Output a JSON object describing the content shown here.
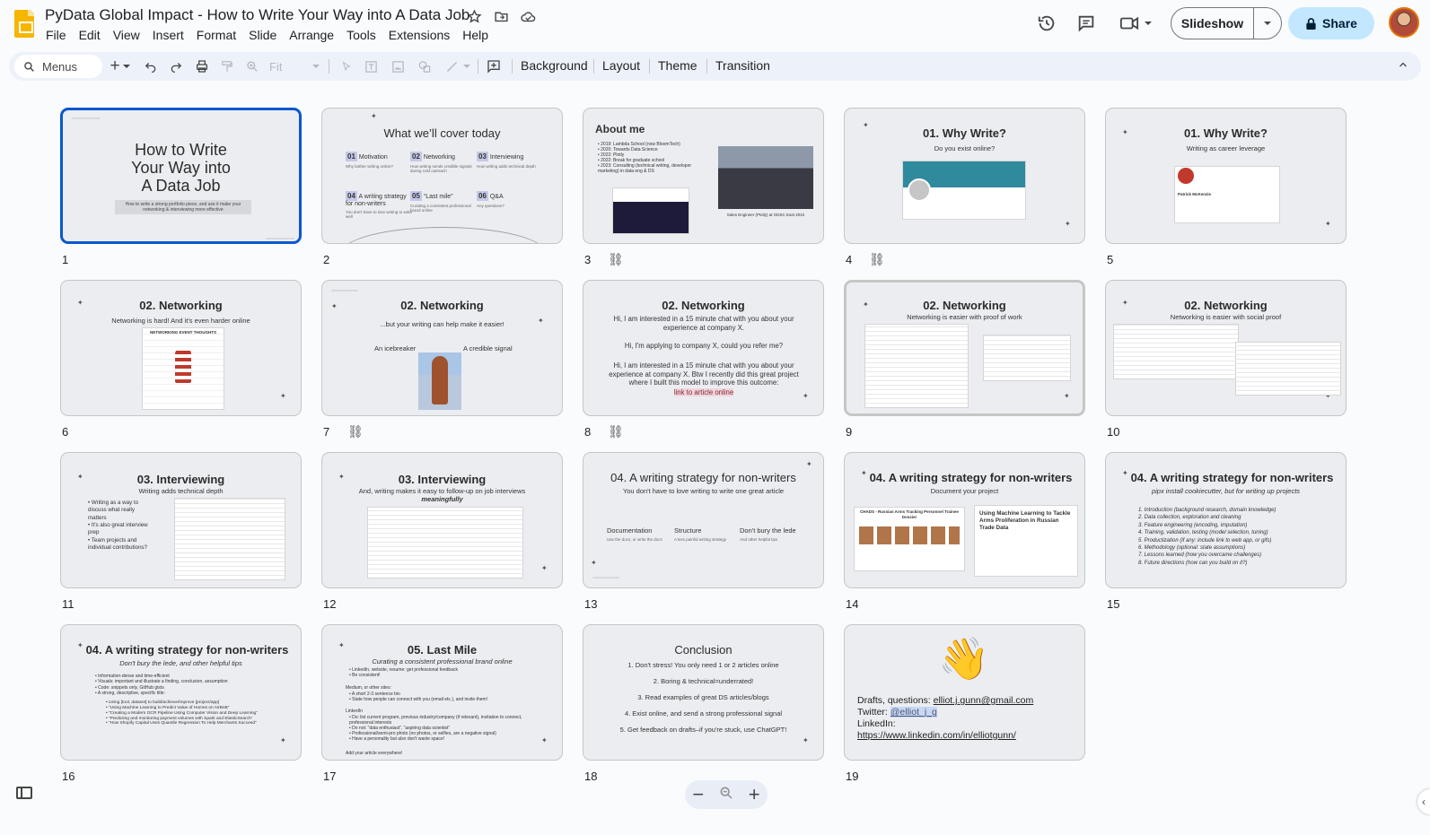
{
  "doc": {
    "title": "PyData Global Impact - How to Write Your Way into A Data Job",
    "menu": [
      "File",
      "Edit",
      "View",
      "Insert",
      "Format",
      "Slide",
      "Arrange",
      "Tools",
      "Extensions",
      "Help"
    ]
  },
  "header": {
    "slideshow_label": "Slideshow",
    "share_label": "Share"
  },
  "toolbar": {
    "search_label": "Menus",
    "zoom_value": "Fit",
    "background_label": "Background",
    "layout_label": "Layout",
    "theme_label": "Theme",
    "transition_label": "Transition"
  },
  "colors": {
    "selection": "#0b57d0",
    "share_bg": "#c2e7ff",
    "toolbar_bg": "#edf2fa",
    "slide_bg": "#ecedf1",
    "logo": "#f7b500"
  },
  "slides": [
    {
      "num": "1",
      "title": "How to Write Your Way into A Data Job",
      "t1": "How to Write",
      "t2": "Your Way into",
      "t3": "A Data Job",
      "subtitle": "How to write a strong portfolio piece, and use it make your networking & interviewing more effective"
    },
    {
      "num": "2",
      "title": "What we’ll cover today",
      "items": [
        {
          "n": "01",
          "label": "Motivation",
          "sub": "Why bother writing online?"
        },
        {
          "n": "02",
          "label": "Networking",
          "sub": "How writing sends credible signals during cold outreach"
        },
        {
          "n": "03",
          "label": "Interviewing",
          "sub": "How writing adds technical depth"
        },
        {
          "n": "04",
          "label": "A writing strategy for non-writers",
          "sub": "You don't have to love writing to write well"
        },
        {
          "n": "05",
          "label": "“Last mile”",
          "sub": "Curating a consistent professional brand online"
        },
        {
          "n": "06",
          "label": "Q&A",
          "sub": "Any questions?"
        }
      ]
    },
    {
      "num": "3",
      "title": "About me",
      "bullets": [
        "2019: Lambda School (now BloomTech)",
        "2020: Towards Data Science",
        "2022: Plotly",
        "2022: Break for graduate school",
        "2023: Consulting (technical writing, developer marketing) in data eng & DS"
      ],
      "caption": "Sales Engineer (Plotly) at ODSC East 2022"
    },
    {
      "num": "4",
      "title": "01. Why Write?",
      "subtitle": "Do you exist online?"
    },
    {
      "num": "5",
      "title": "01. Why Write?",
      "subtitle": "Writing as career leverage",
      "name": "Patrick McKenzie"
    },
    {
      "num": "6",
      "title": "02. Networking",
      "subtitle": "Networking is hard! And it's even harder online",
      "comic": "NETWORKING EVENT THOUGHTS"
    },
    {
      "num": "7",
      "title": "02. Networking",
      "subtitle": "...but your writing can help make it easier!",
      "left": "An icebreaker",
      "right": "A credible signal"
    },
    {
      "num": "8",
      "title": "02. Networking",
      "p1": "Hi, I am interested in a 15 minute chat with you about your experience at company X.",
      "p2": "Hi, I'm applying to company X, could you refer me?",
      "p3": "Hi, I am interested in a 15 minute chat with you about your experience at company X. Btw I recently did this great project where I built this model to improve this outcome:",
      "link": "link to article online"
    },
    {
      "num": "9",
      "title": "02. Networking",
      "subtitle": "Networking is easier with proof of work"
    },
    {
      "num": "10",
      "title": "02. Networking",
      "subtitle": "Networking is easier with social proof"
    },
    {
      "num": "11",
      "title": "03. Interviewing",
      "subtitle": "Writing adds technical depth",
      "bullets": [
        "Writing as a way to discuss what really matters",
        "It's also great interview prep",
        "Team projects and individual contributions?"
      ]
    },
    {
      "num": "12",
      "title": "03. Interviewing",
      "subtitle": "And, writing makes it easy to follow-up on job interviews",
      "subtitle2": "meaningfully"
    },
    {
      "num": "13",
      "title": "04. A writing strategy for non-writers",
      "subtitle": "You don't have to love writing to write one great article",
      "cols": [
        {
          "h": "Documentation",
          "s": "Use the docs, or write the docs"
        },
        {
          "h": "Structure",
          "s": "A less painful writing strategy"
        },
        {
          "h": "Don't bury the lede",
          "s": "And other helpful tips"
        }
      ]
    },
    {
      "num": "14",
      "title": "04. A writing strategy for non-writers",
      "subtitle": "Document your project",
      "left": "CHADS - Russian Arms Tracking Personnel Trainee Dossier",
      "right": "Using Machine Learning to Tackle Arms Proliferation in Russian Trade Data"
    },
    {
      "num": "15",
      "title": "04. A writing strategy for non-writers",
      "subtitle": "pipx install cookiecutter, but for writing up projects",
      "items": [
        "Introduction (background research, domain knowledge)",
        "Data collection, exploration and cleaning",
        "Feature engineering (encoding, imputation)",
        "Training, validation, testing (model selection, tuning)",
        "Productization (if any: include link to web app, or gifs)",
        "Methodology (optional: state assumptions)",
        "Lessons learned (how you overcame challenges)",
        "Future directions (how can you build on it?)"
      ]
    },
    {
      "num": "16",
      "title": "04. A writing strategy for non-writers",
      "subtitle": "Don't bury the lede, and other helpful tips",
      "bullets": [
        "Information-dense and time-efficient",
        "Visuals: important and illustrate a finding, conclusion, assumption",
        "Code: snippets only, GitHub gists",
        "A strong, descriptive, specific title:"
      ],
      "subs": [
        "Using [tool, dataset] to build/achieve/improve [project/app]",
        "“Using Machine Learning to Predict Value of Homes on AirBnB”",
        "“Creating a Modern OCR Pipeline Using Computer Vision and Deep Learning”",
        "“Predicting and monitoring payment volumes with Spark and ElasticSearch”",
        "“How Shopify Capital Uses Quantile Regression To Help Merchants Succeed”"
      ]
    },
    {
      "num": "17",
      "title": "05. Last Mile",
      "subtitle": "Curating a consistent professional brand online",
      "b1": [
        "LinkedIn, website, resume: get professional feedback",
        "Be consistent!"
      ],
      "h2": "Medium, or other sites:",
      "b2": [
        "A short 2-3 sentence bio",
        "State how people can connect with you (email etc.), and invite them!"
      ],
      "h3": "LinkedIn",
      "b3": [
        "Do: list current program, previous industry/company (if relevant), invitation to connect, professional interests",
        "Do not: “data enthusiast”, “aspiring data scientist”",
        "Professional/semi-pro photo (no photos, or selfies, are a negative signal)",
        "Have a personality but also don't waste space!"
      ],
      "footer": "Add your article everywhere!"
    },
    {
      "num": "18",
      "title": "Conclusion",
      "items": [
        "1.  Don't stress! You only need 1 or 2 articles online",
        "2.  Boring & technical=underrated!",
        "3.  Read examples of great DS articles/blogs",
        "4.  Exist online, and send a strong professional signal",
        "5.  Get feedback on drafts–if you're stuck, use ChatGPT!"
      ]
    },
    {
      "num": "19",
      "emoji": "👋",
      "l1a": "Drafts, questions: ",
      "l1b": "elliot.j.gunn@gmail.com",
      "l2a": "Twitter: ",
      "l2b": "@elliot_j_g",
      "l3": "LinkedIn:",
      "l4": "https://www.linkedin.com/in/elliotgunn/"
    }
  ]
}
